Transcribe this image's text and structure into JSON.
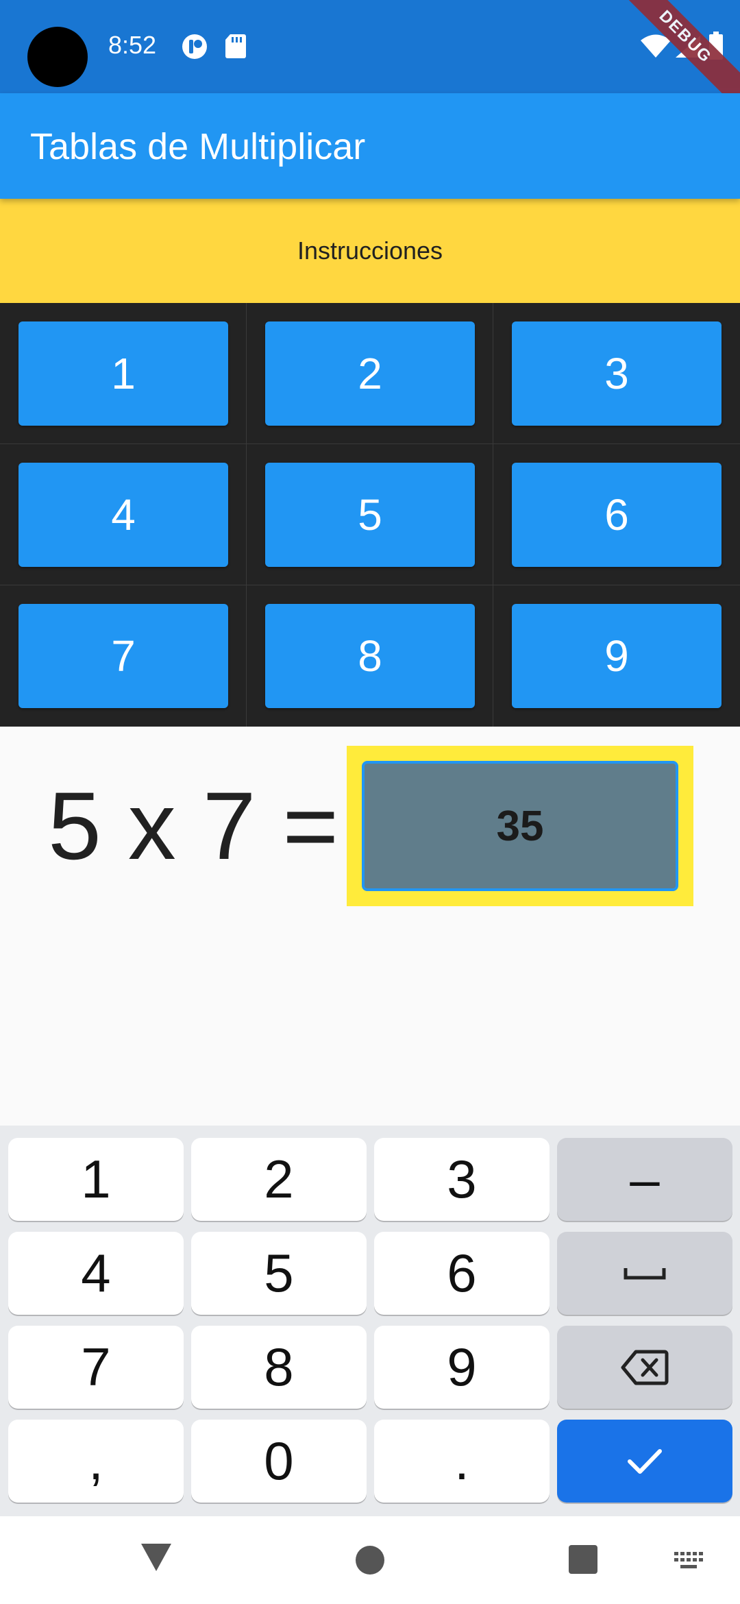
{
  "status_bar": {
    "time": "8:52",
    "icons": [
      "camera-cutout",
      "notification-app-icon",
      "sd-card-icon",
      "wifi-icon",
      "signal-icon",
      "battery-icon"
    ],
    "debug_banner": "DEBUG"
  },
  "app_bar": {
    "title": "Tablas de Multiplicar"
  },
  "instructions_button": "Instrucciones",
  "table_buttons": [
    "1",
    "2",
    "3",
    "4",
    "5",
    "6",
    "7",
    "8",
    "9"
  ],
  "question": {
    "equation": "5 x 7 =",
    "answer_value": "35"
  },
  "keyboard": {
    "rows": [
      [
        "1",
        "2",
        "3",
        "–"
      ],
      [
        "4",
        "5",
        "6",
        "space"
      ],
      [
        "7",
        "8",
        "9",
        "backspace"
      ],
      [
        ",",
        "0",
        ".",
        "done"
      ]
    ]
  },
  "nav_bar": {
    "icons": [
      "back-icon",
      "home-icon",
      "recents-icon",
      "keyboard-switch-icon"
    ]
  },
  "colors": {
    "status_bar": "#1976d2",
    "app_bar": "#2196f3",
    "instructions_bg": "#ffd740",
    "grid_bg": "#232323",
    "answer_frame": "#ffeb3b",
    "answer_field": "#607d8b",
    "keyboard_done": "#1a73e8"
  }
}
